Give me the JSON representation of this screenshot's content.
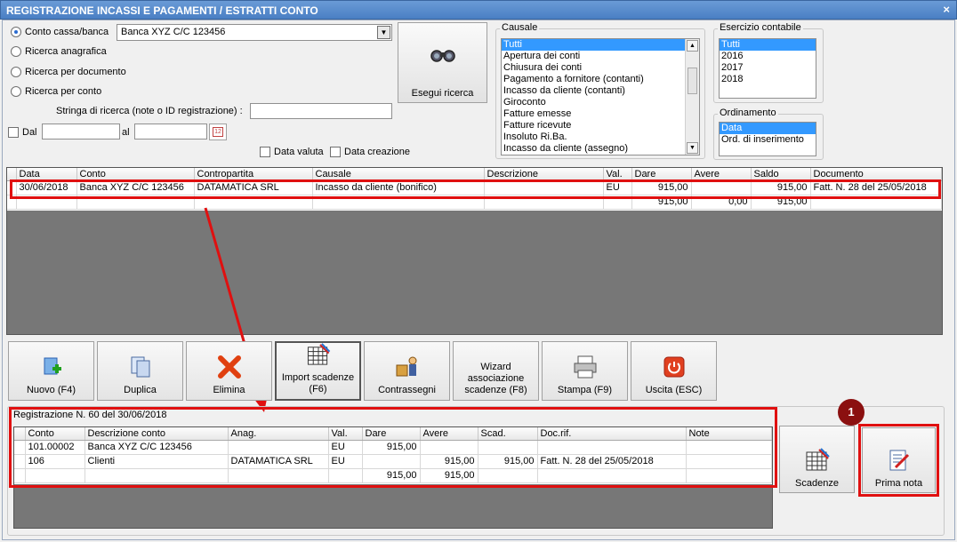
{
  "window": {
    "title": "REGISTRAZIONE INCASSI E PAGAMENTI / ESTRATTI CONTO",
    "close_glyph": "×"
  },
  "search": {
    "options": [
      "Conto cassa/banca",
      "Ricerca anagrafica",
      "Ricerca per documento",
      "Ricerca per conto"
    ],
    "selected_option": "Conto cassa/banca",
    "account_combo_value": "Banca XYZ C/C 123456",
    "search_string_label": "Stringa di ricerca (note o ID registrazione) :",
    "search_string_value": "",
    "dal_label": "Dal",
    "al_label": "al",
    "date_from": "",
    "date_to": "",
    "calendar_day": "12",
    "data_valuta_label": "Data valuta",
    "data_creazione_label": "Data creazione",
    "run_button_label": "Esegui ricerca"
  },
  "causale": {
    "label": "Causale",
    "items": [
      "Tutti",
      "Apertura dei conti",
      "Chiusura dei conti",
      "Pagamento a fornitore (contanti)",
      "Incasso da cliente (contanti)",
      "Giroconto",
      "Fatture emesse",
      "Fatture ricevute",
      "Insoluto Ri.Ba.",
      "Incasso da cliente (assegno)"
    ],
    "selected": "Tutti"
  },
  "esercizio": {
    "label": "Esercizio contabile",
    "items": [
      "Tutti",
      "2016",
      "2017",
      "2018"
    ],
    "selected": "Tutti"
  },
  "ordinamento": {
    "label": "Ordinamento",
    "items": [
      "Data",
      "Ord. di inserimento"
    ],
    "selected": "Data"
  },
  "main_grid": {
    "columns": [
      "Data",
      "Conto",
      "Contropartita",
      "Causale",
      "Descrizione",
      "Val.",
      "Dare",
      "Avere",
      "Saldo",
      "Documento"
    ],
    "rows": [
      [
        "30/06/2018",
        "Banca XYZ C/C 123456",
        "DATAMATICA SRL",
        "Incasso da cliente (bonifico)",
        "",
        "EU",
        "915,00",
        "",
        "915,00",
        "Fatt. N. 28 del 25/05/2018"
      ]
    ],
    "totals": [
      "",
      "",
      "",
      "",
      "",
      "",
      "915,00",
      "0,00",
      "915,00",
      ""
    ]
  },
  "toolbar": {
    "buttons": [
      {
        "label": "Nuovo (F4)",
        "icon": "add-icon"
      },
      {
        "label": "Duplica",
        "icon": "duplicate-icon"
      },
      {
        "label": "Elimina",
        "icon": "delete-x-icon"
      },
      {
        "label": "Import scadenze\n(F6)",
        "icon": "import-grid-icon"
      },
      {
        "label": "Contrassegni",
        "icon": "courier-icon"
      },
      {
        "label": "Wizard\nassociazione\nscadenze (F8)",
        "icon": ""
      },
      {
        "label": "Stampa (F9)",
        "icon": "printer-icon"
      },
      {
        "label": "Uscita (ESC)",
        "icon": "power-icon"
      }
    ]
  },
  "registration": {
    "title": "Registrazione N. 60 del 30/06/2018",
    "columns": [
      "Conto",
      "Descrizione conto",
      "Anag.",
      "Val.",
      "Dare",
      "Avere",
      "Scad.",
      "Doc.rif.",
      "Note"
    ],
    "rows": [
      [
        "101.00002",
        "Banca XYZ C/C 123456",
        "",
        "EU",
        "915,00",
        "",
        "",
        "",
        ""
      ],
      [
        "106",
        "Clienti",
        "DATAMATICA SRL",
        "EU",
        "",
        "915,00",
        "915,00",
        "Fatt. N. 28 del 25/05/2018",
        ""
      ]
    ],
    "totals": [
      "",
      "",
      "",
      "",
      "915,00",
      "915,00",
      "",
      "",
      ""
    ]
  },
  "side_buttons": {
    "scadenze_label": "Scadenze",
    "prima_nota_label": "Prima nota"
  },
  "annotation": {
    "badge": "1",
    "highlight_color": "#e01010",
    "badge_color": "#8b1010"
  }
}
